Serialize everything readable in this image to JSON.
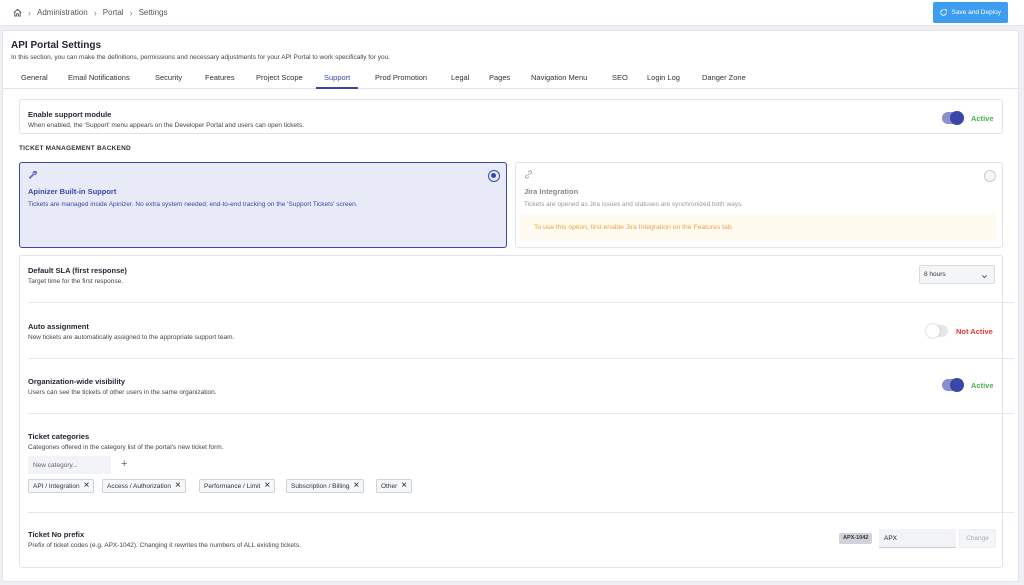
{
  "breadcrumb": {
    "home_icon": "home-icon",
    "items": [
      "Administration",
      "Portal",
      "Settings"
    ]
  },
  "header": {
    "save_label": "Save and Deploy"
  },
  "page": {
    "title": "API Portal Settings",
    "subtitle": "In this section, you can make the definitions, permissions and necessary adjustments for your API Portal to work specifically for you."
  },
  "tabs": [
    {
      "label": "General"
    },
    {
      "label": "Email Notifications"
    },
    {
      "label": "Security"
    },
    {
      "label": "Features"
    },
    {
      "label": "Project Scope"
    },
    {
      "label": "Support"
    },
    {
      "label": "Prod Promotion"
    },
    {
      "label": "Legal"
    },
    {
      "label": "Pages"
    },
    {
      "label": "Navigation Menu"
    },
    {
      "label": "SEO"
    },
    {
      "label": "Login Log"
    },
    {
      "label": "Danger Zone"
    }
  ],
  "active_tab": "Support",
  "support_module": {
    "title": "Enable support module",
    "desc": "When enabled, the 'Support' menu appears on the Developer Portal and users can open tickets.",
    "status": "Active",
    "enabled": true
  },
  "backend": {
    "section_title": "TICKET MANAGEMENT BACKEND",
    "builtin": {
      "title": "Apinizer Built-in Support",
      "desc": "Tickets are managed inside Apinizer. No extra system needed; end-to-end tracking on the 'Support Tickets' screen.",
      "selected": true
    },
    "jira": {
      "title": "Jira Integration",
      "desc": "Tickets are opened as Jira issues and statuses are synchronized both ways.",
      "warning": "To use this option, first enable Jira Integration on the Features tab.",
      "selected": false
    }
  },
  "sla": {
    "title": "Default SLA (first response)",
    "desc": "Target time for the first response.",
    "value": "8 hours"
  },
  "auto_assignment": {
    "title": "Auto assignment",
    "desc": "New tickets are automatically assigned to the appropriate support team.",
    "status": "Not Active",
    "enabled": false
  },
  "visibility": {
    "title": "Organization-wide visibility",
    "desc": "Users can see the tickets of other users in the same organization.",
    "status": "Active",
    "enabled": true
  },
  "categories": {
    "title": "Ticket categories",
    "desc": "Categories offered in the category list of the portal's new ticket form.",
    "placeholder": "New category...",
    "add_label": "+",
    "items": [
      "API / Integration",
      "Access / Authorization",
      "Performance / Limit",
      "Subscription / Billing",
      "Other"
    ]
  },
  "prefix": {
    "title": "Ticket No prefix",
    "desc": "Prefix of ticket codes (e.g. APX-1042). Changing it rewrites the numbers of ALL existing tickets.",
    "example": "APX-1042",
    "value": "APX",
    "change_label": "Change"
  },
  "colors": {
    "accent": "#3947a8",
    "save_button": "#3d9df0",
    "active": "#4caf50",
    "inactive": "#e53935",
    "warning_text": "#f0a04b"
  }
}
